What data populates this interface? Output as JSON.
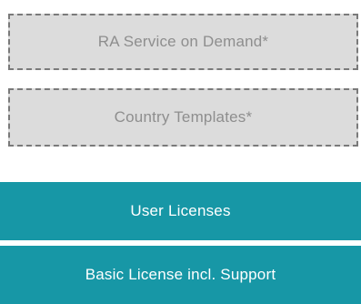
{
  "optional_modules": [
    {
      "label": "RA Service on Demand*"
    },
    {
      "label": "Country Templates*"
    }
  ],
  "core_modules": [
    {
      "label": "User Licenses"
    },
    {
      "label": "Basic License incl. Support"
    }
  ],
  "colors": {
    "optional_fill": "#dcdcdc",
    "optional_border": "#7a7a7a",
    "optional_text": "#8e8e8e",
    "core_fill": "#1797a6",
    "core_text": "#ffffff"
  }
}
